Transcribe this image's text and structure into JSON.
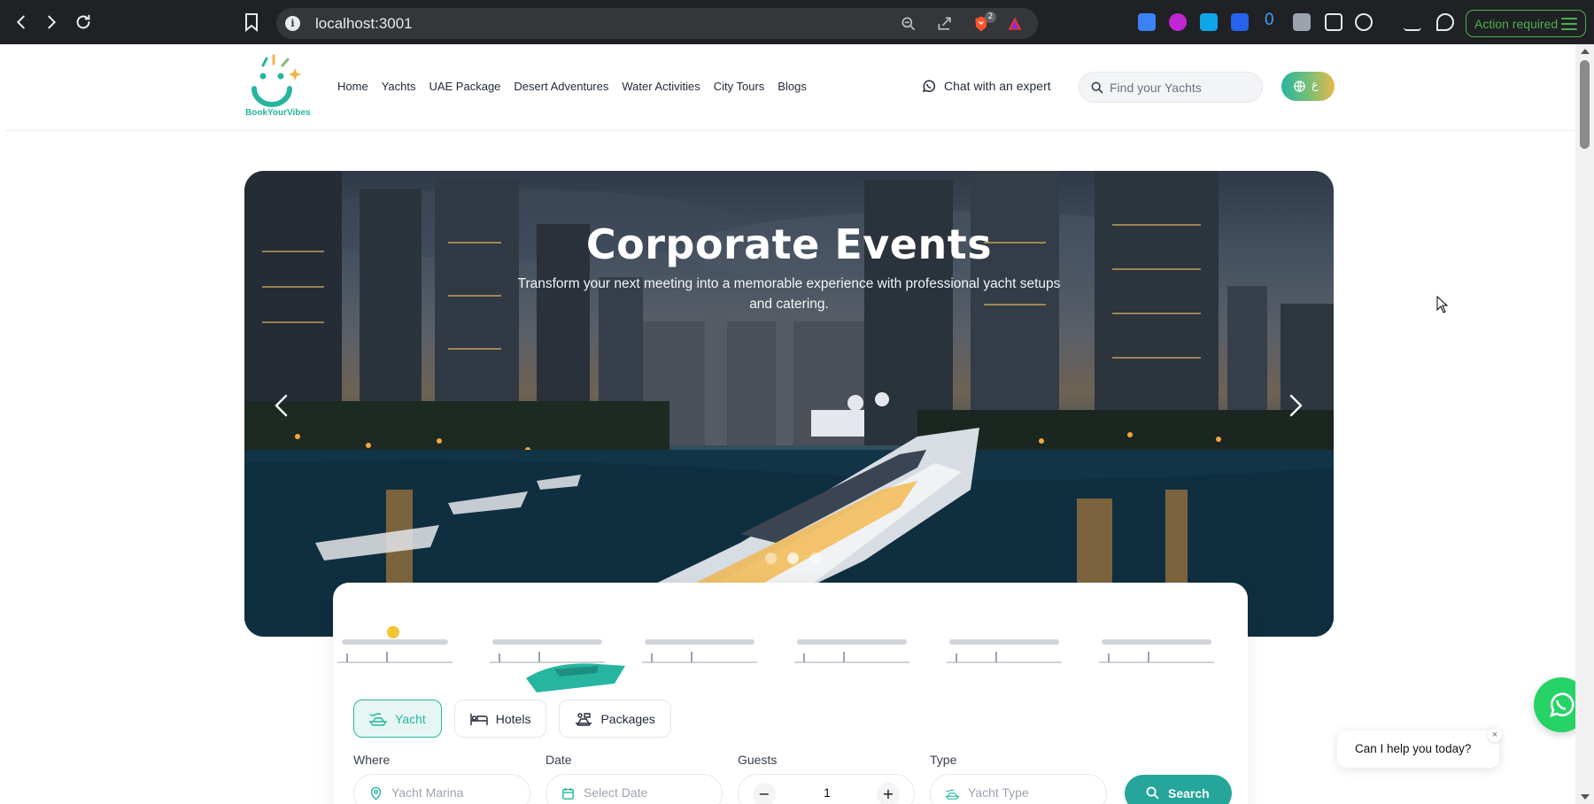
{
  "browser": {
    "url": "localhost:3001",
    "brave_badge": "2",
    "ext_counter": "0",
    "action_required": "Action required"
  },
  "header": {
    "brand": "BookYourVibes",
    "nav": [
      "Home",
      "Yachts",
      "UAE Package",
      "Desert Adventures",
      "Water Activities",
      "City Tours",
      "Blogs"
    ],
    "chat_label": "Chat with an expert",
    "search_placeholder": "Find your Yachts",
    "lang_label": "ع"
  },
  "hero": {
    "title": "Corporate Events",
    "subtitle": "Transform your next meeting into a memorable experience with professional yacht setups and catering.",
    "slides_total": 3,
    "active_slide": 2
  },
  "booking": {
    "tabs": [
      {
        "label": "Yacht",
        "icon": "yacht-icon",
        "active": true
      },
      {
        "label": "Hotels",
        "icon": "bed-icon",
        "active": false
      },
      {
        "label": "Packages",
        "icon": "package-icon",
        "active": false
      }
    ],
    "where": {
      "label": "Where",
      "placeholder": "Yacht Marina"
    },
    "date": {
      "label": "Date",
      "placeholder": "Select Date"
    },
    "guests": {
      "label": "Guests",
      "value": "1",
      "minus": "−",
      "plus": "+"
    },
    "type": {
      "label": "Type",
      "placeholder": "Yacht Type"
    },
    "search_label": "Search"
  },
  "chat_widget": {
    "prompt": "Can I help you today?",
    "close": "×"
  },
  "colors": {
    "accent": "#26b5a0",
    "button": "#26a69a",
    "whatsapp": "#25d366",
    "chrome_bg": "#202124",
    "action_green": "#4caf50"
  }
}
